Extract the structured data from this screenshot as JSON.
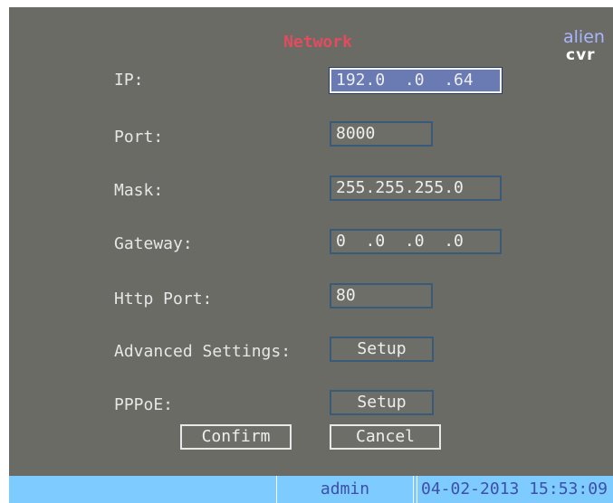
{
  "window": {
    "title": "Network"
  },
  "logo": {
    "line1": "alien",
    "line2": "cvr"
  },
  "fields": {
    "ip": {
      "label": "IP:",
      "value": "192.0  .0  .64"
    },
    "port": {
      "label": "Port:",
      "value": "8000"
    },
    "mask": {
      "label": "Mask:",
      "value": "255.255.255.0"
    },
    "gateway": {
      "label": "Gateway:",
      "value": "0  .0  .0  .0"
    },
    "http_port": {
      "label": "Http Port:",
      "value": "80"
    },
    "advanced": {
      "label": "Advanced Settings:",
      "button": "Setup"
    },
    "pppoe": {
      "label": "PPPoE:",
      "button": "Setup"
    }
  },
  "actions": {
    "confirm": "Confirm",
    "cancel": "Cancel"
  },
  "status": {
    "user": "admin",
    "datetime": "04-02-2013 15:53:09"
  },
  "colors": {
    "background": "#6b6b66",
    "title": "#e44b5d",
    "status_bar": "#7ecbff",
    "active_field": "#6a7ab2"
  },
  "state": {
    "focused_field": "ip"
  }
}
